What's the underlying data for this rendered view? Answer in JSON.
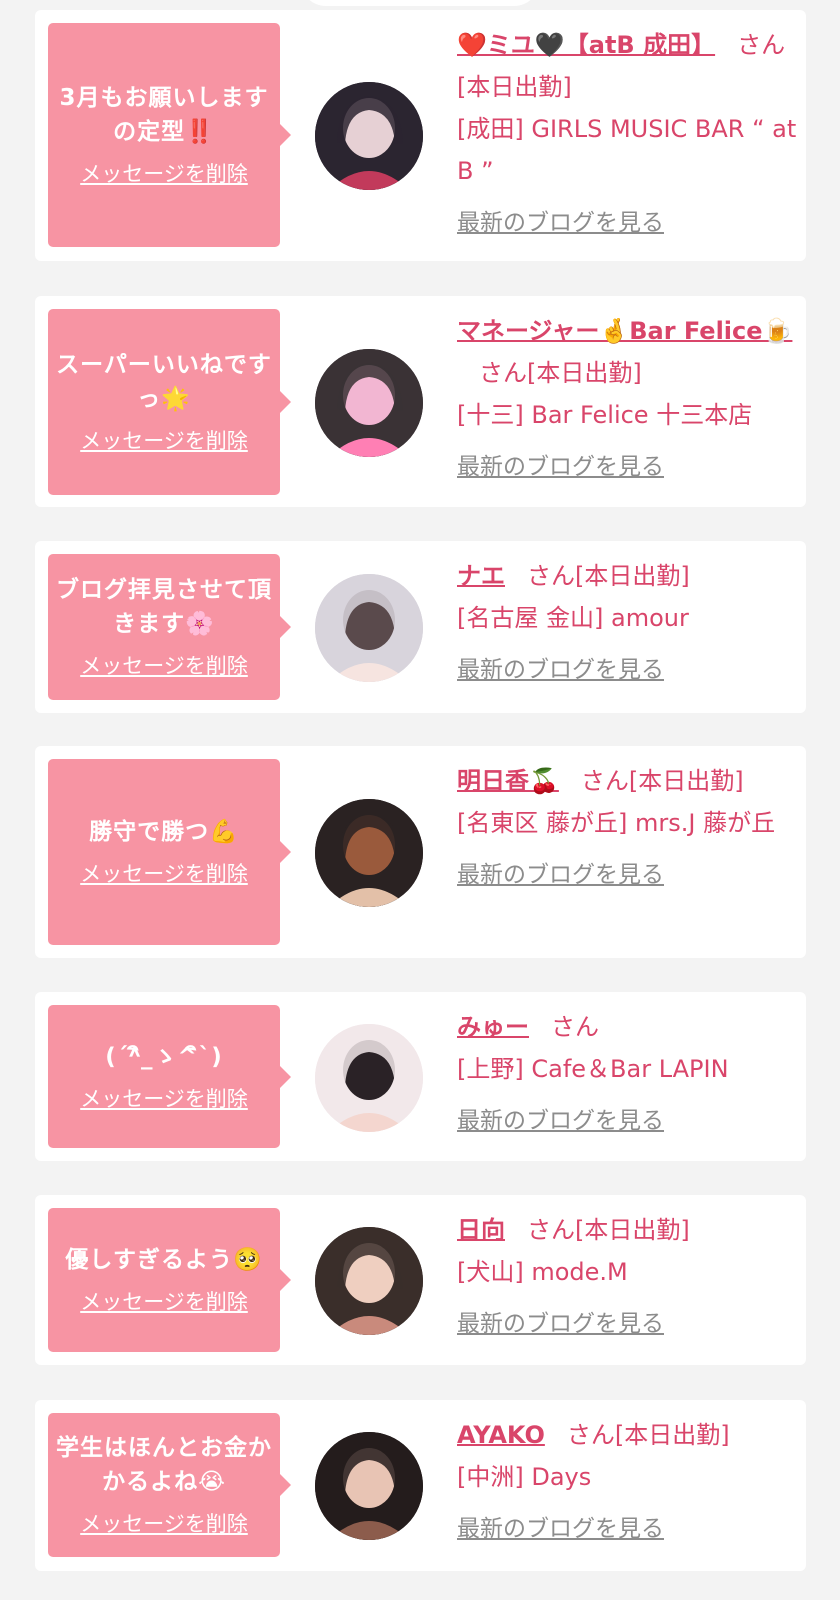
{
  "cards": [
    {
      "message": "3月もお願いしますの定型‼️",
      "delete_label": "メッセージを削除",
      "name": "❤️ミユ🖤【atB 成田】",
      "san": "さん",
      "status": "[本日出勤]",
      "shop": "[成田] GIRLS MUSIC BAR “ at B ”",
      "blog_label": "最新のブログを見る",
      "avatar_icon": "profile-photo",
      "avatar_colors": [
        "#2b2530",
        "#e6d0d4",
        "#c23a5b"
      ]
    },
    {
      "message": "スーパーいいねですっ🌟",
      "delete_label": "メッセージを削除",
      "name": "マネージャー🤞Bar Felice🍺",
      "san": "さん",
      "status": "[本日出勤]",
      "shop": "[十三] Bar Felice 十三本店",
      "blog_label": "最新のブログを見る",
      "avatar_icon": "profile-photo",
      "avatar_colors": [
        "#3a3235",
        "#f2b6d2",
        "#ff7fb4"
      ]
    },
    {
      "message": "ブログ拝見させて頂きます🌸",
      "delete_label": "メッセージを削除",
      "name": "ナエ",
      "san": "さん",
      "status": "[本日出勤]",
      "shop": "[名古屋 金山] amour",
      "blog_label": "最新のブログを見る",
      "avatar_icon": "profile-photo",
      "avatar_colors": [
        "#d8d4dc",
        "#5a4a4c",
        "#f6e4e0"
      ]
    },
    {
      "message": "勝守で勝つ💪",
      "delete_label": "メッセージを削除",
      "name": "明日香🍒",
      "san": "さん",
      "status": "[本日出勤]",
      "shop": "[名東区 藤が丘] mrs.J 藤が丘",
      "blog_label": "最新のブログを見る",
      "avatar_icon": "profile-photo",
      "avatar_colors": [
        "#2a2222",
        "#9a5a3c",
        "#e3c0a8"
      ]
    },
    {
      "message": "(´^ิ_ゝ^ิ`)",
      "delete_label": "メッセージを削除",
      "name": "みゅー",
      "san": "さん",
      "status": "",
      "shop": "[上野] Cafe＆Bar LAPIN",
      "blog_label": "最新のブログを見る",
      "avatar_icon": "profile-photo",
      "avatar_colors": [
        "#f2e8ea",
        "#2a2226",
        "#f4d6cf"
      ]
    },
    {
      "message": "優しすぎるよう🥺",
      "delete_label": "メッセージを削除",
      "name": "日向",
      "san": "さん",
      "status": "[本日出勤]",
      "shop": "[犬山] mode.M",
      "blog_label": "最新のブログを見る",
      "avatar_icon": "profile-photo",
      "avatar_colors": [
        "#3a2e2a",
        "#efcfc0",
        "#c98a7c"
      ]
    },
    {
      "message": "学生はほんとお金かかるよね😭",
      "delete_label": "メッセージを削除",
      "name": "AYAKO",
      "san": "さん",
      "status": "[本日出勤]",
      "shop": "[中洲] Days",
      "blog_label": "最新のブログを見る",
      "avatar_icon": "profile-photo",
      "avatar_colors": [
        "#241c1c",
        "#e8c4b4",
        "#8c5c4c"
      ]
    }
  ]
}
